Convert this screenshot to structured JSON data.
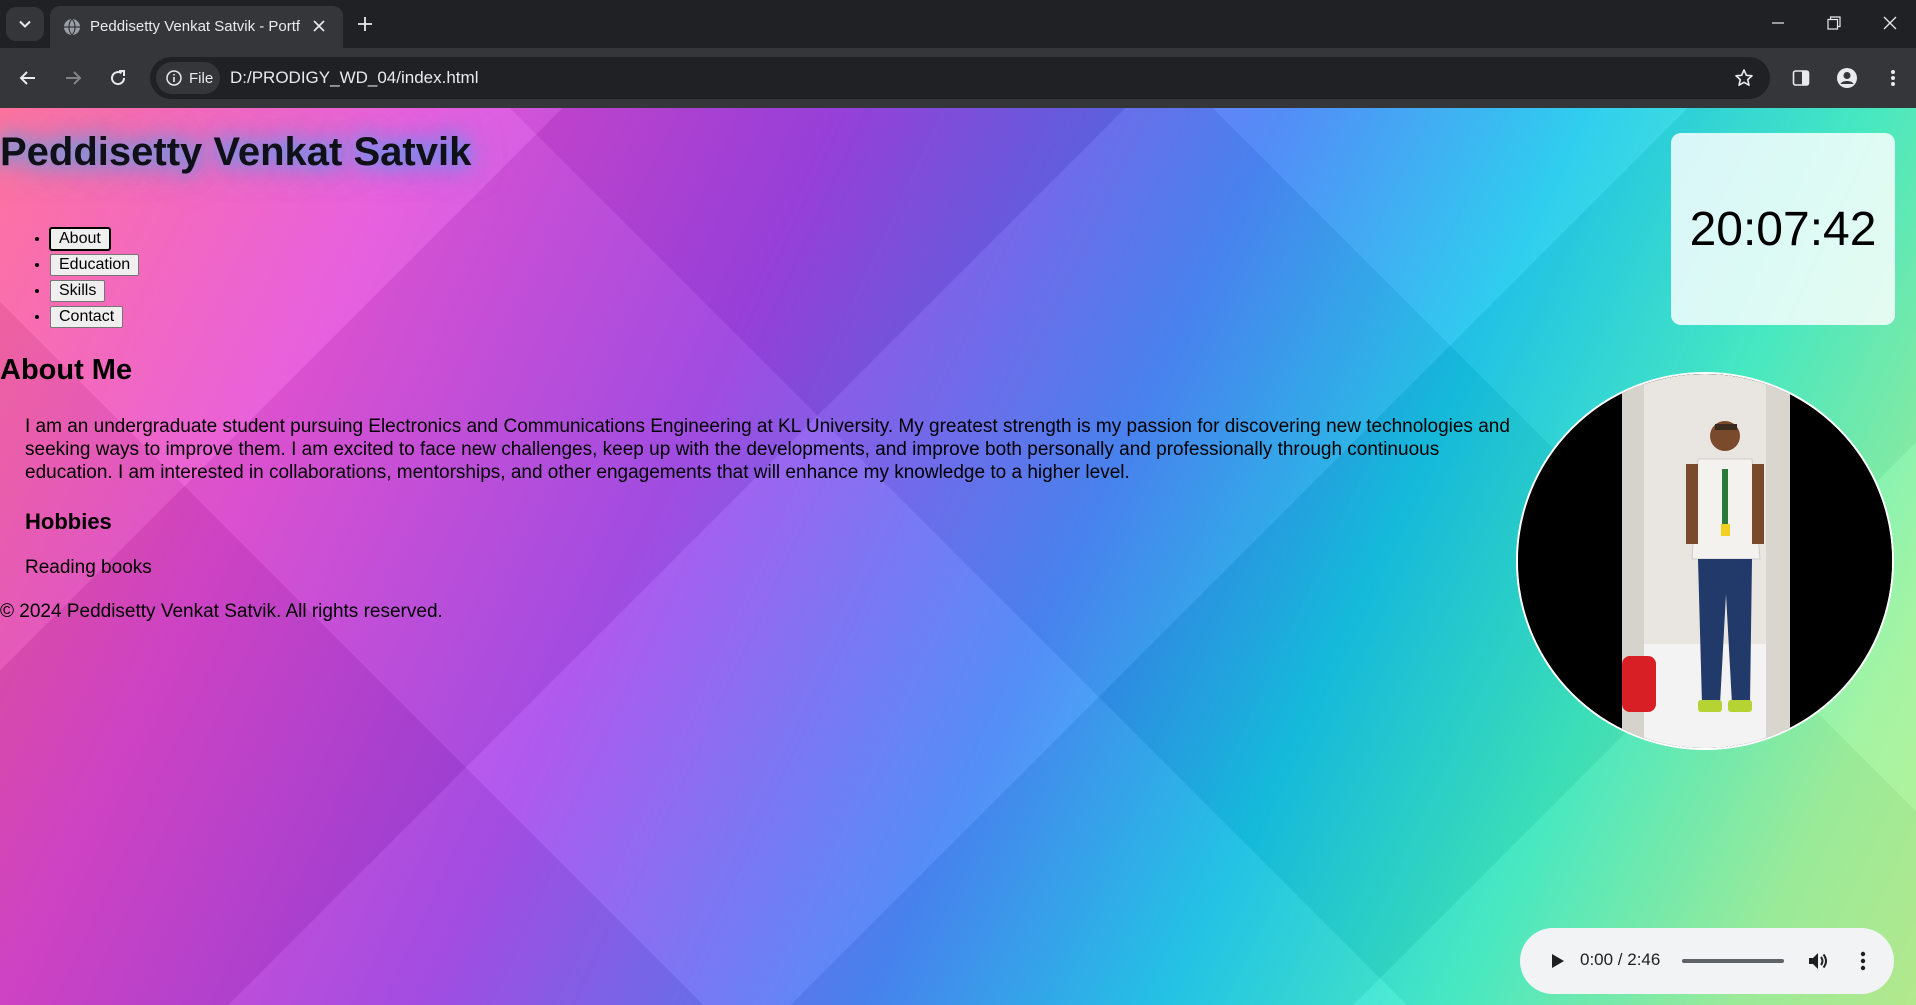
{
  "browser": {
    "tab_title": "Peddisetty Venkat Satvik - Portfolio",
    "address_chip": "File",
    "url": "D:/PRODIGY_WD_04/index.html"
  },
  "page": {
    "title": "Peddisetty Venkat Satvik",
    "nav": [
      "About",
      "Education",
      "Skills",
      "Contact"
    ],
    "active_nav": "About",
    "about_heading": "About Me",
    "about_text": "I am an undergraduate student pursuing Electronics and Communications Engineering at KL University. My greatest strength is my passion for discovering new technologies and seeking ways to improve them. I am excited to face new challenges, keep up with the developments, and improve both personally and professionally through continuous education. I am interested in collaborations, mentorships, and other engagements that will enhance my knowledge to a higher level.",
    "hobbies_heading": "Hobbies",
    "hobbies": [
      "Reading books"
    ],
    "footer": "© 2024 Peddisetty Venkat Satvik. All rights reserved.",
    "clock": "20:07:42",
    "audio_time": "0:00 / 2:46"
  }
}
